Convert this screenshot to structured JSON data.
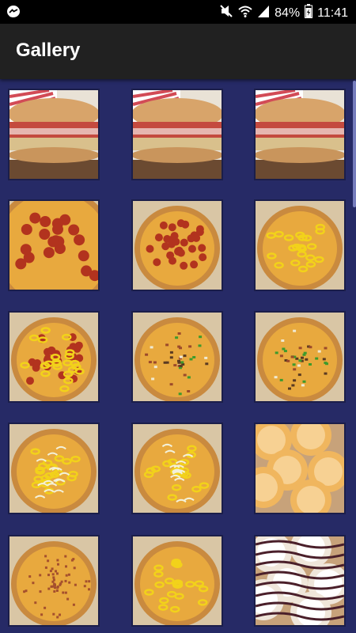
{
  "status_bar": {
    "battery_percent": "84%",
    "time": "11:41",
    "icons": [
      "messenger-icon",
      "mute-icon",
      "wifi-icon",
      "signal-icon",
      "battery-icon"
    ]
  },
  "app_bar": {
    "title": "Gallery"
  },
  "gallery": {
    "items": [
      {
        "kind": "sub-sandwich"
      },
      {
        "kind": "sub-sandwich"
      },
      {
        "kind": "sub-sandwich"
      },
      {
        "kind": "pepperoni-pizza-closeup"
      },
      {
        "kind": "pepperoni-pizza"
      },
      {
        "kind": "banana-pepper-pizza"
      },
      {
        "kind": "banana-pepper-pepperoni-pizza"
      },
      {
        "kind": "supreme-pizza"
      },
      {
        "kind": "veggie-pizza"
      },
      {
        "kind": "banana-pepper-onion-pizza"
      },
      {
        "kind": "banana-pepper-onion-pizza"
      },
      {
        "kind": "cinnamon-rolls"
      },
      {
        "kind": "bacon-pizza"
      },
      {
        "kind": "banana-pepper-pizza"
      },
      {
        "kind": "pastry-drizzle"
      }
    ]
  }
}
